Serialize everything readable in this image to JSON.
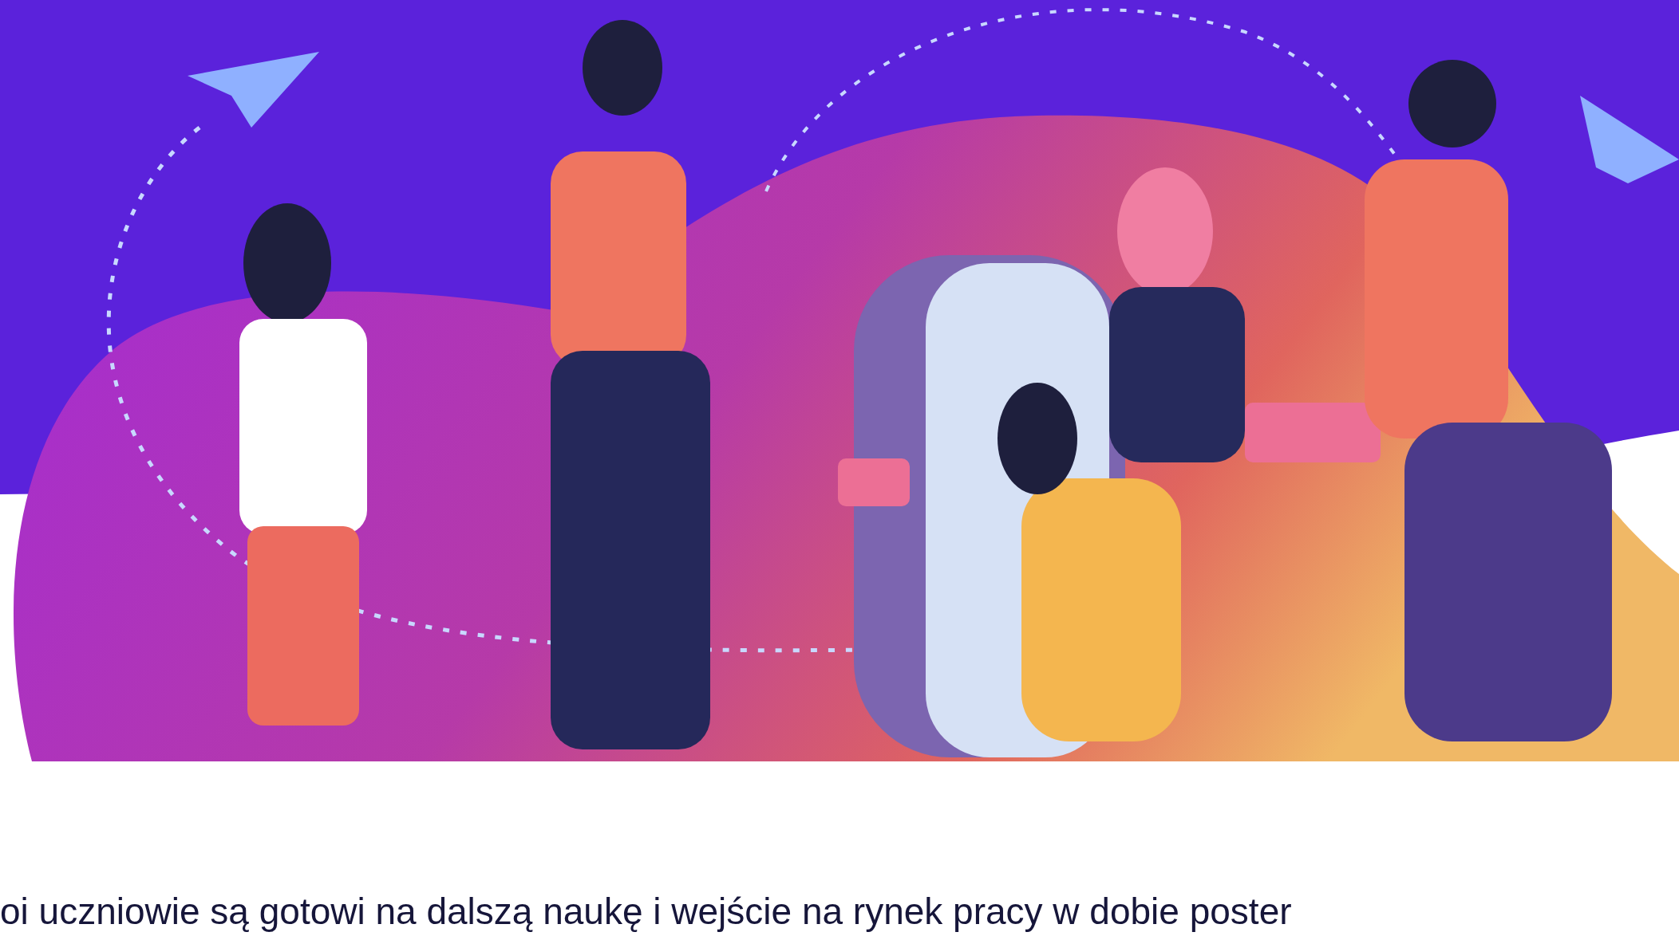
{
  "intro_text": "oi uczniowie są gotowi na dalszą naukę i wejście na rynek pracy w dobie poster"
}
